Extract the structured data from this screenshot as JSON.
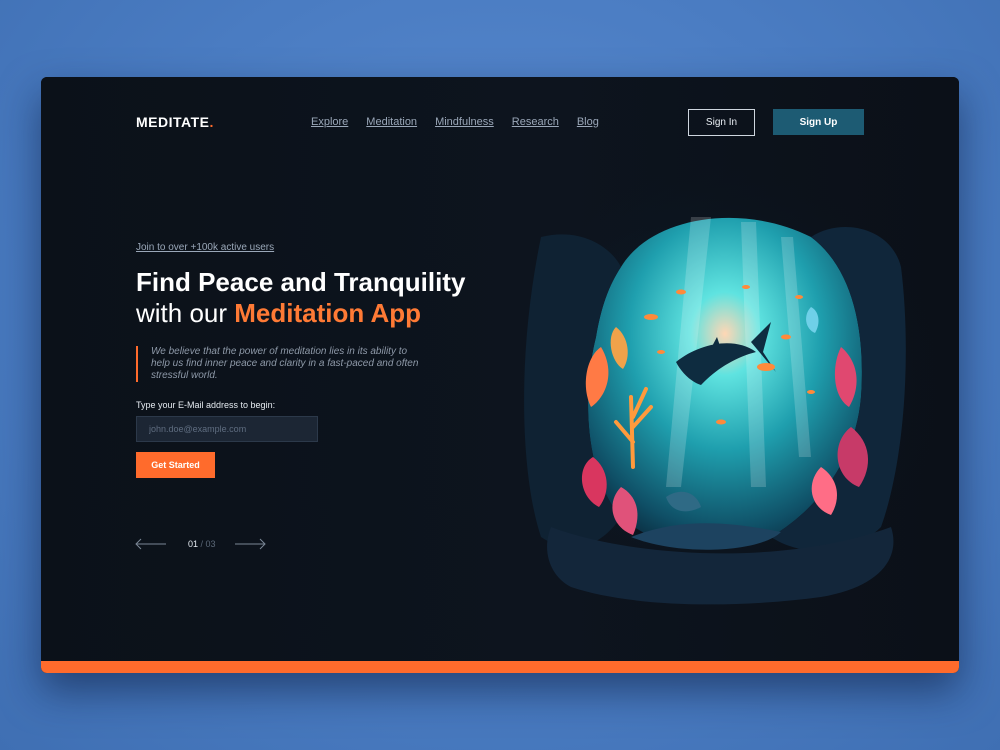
{
  "brand": {
    "name": "MEDITATE",
    "dot": ".",
    "accent": "#ff6b2c"
  },
  "nav": {
    "items": [
      "Explore",
      "Meditation",
      "Mindfulness",
      "Research",
      "Blog"
    ]
  },
  "auth": {
    "sign_in": "Sign In",
    "sign_up": "Sign Up"
  },
  "hero": {
    "join_link": "Join to over +100k active users",
    "title_line1": "Find Peace and Tranquility",
    "title_line2_prefix": "with our ",
    "title_line2_accent": "Meditation App",
    "quote": "We believe that the power of meditation lies in its ability to help us find inner peace and clarity in a fast-paced and often stressful world.",
    "email_label": "Type your E-Mail address to begin:",
    "email_placeholder": "john.doe@example.com",
    "email_value": "",
    "cta": "Get Started"
  },
  "pager": {
    "current": "01",
    "separator": " / ",
    "total": "03"
  },
  "illustration": {
    "icon": "underwater-cave-illustration"
  },
  "colors": {
    "orange": "#ff6b2c",
    "teal": "#1d5b73",
    "background": "#0c121b"
  }
}
